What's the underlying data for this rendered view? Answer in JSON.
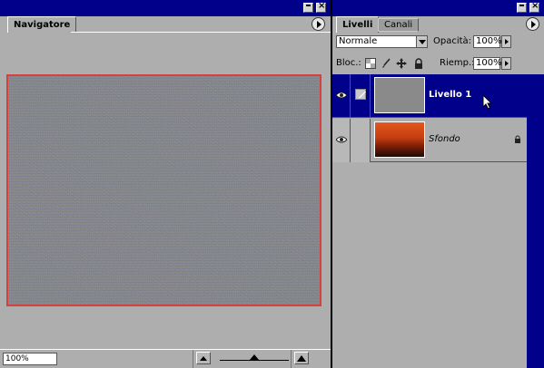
{
  "navigator": {
    "tab": "Navigatore",
    "zoom": "100%"
  },
  "layers": {
    "tabs": [
      "Livelli",
      "Canali"
    ],
    "blend_mode": "Normale",
    "opacity_label": "Opacità:",
    "opacity_value": "100%",
    "lock_label": "Bloc.:",
    "fill_label": "Riemp.:",
    "fill_value": "100%",
    "items": [
      {
        "name": "Livello 1",
        "selected": true,
        "visible": true
      },
      {
        "name": "Sfondo",
        "selected": false,
        "visible": true,
        "locked": true
      }
    ]
  },
  "colors": {
    "title_bar": "#00008b",
    "panel_bg": "#aeaeae",
    "navigator_box": "#d84040",
    "selection": "#00008b"
  },
  "icons": [
    "minimize-icon",
    "close-icon",
    "panel-menu-icon",
    "eye-icon",
    "brush-icon",
    "lock-transparency-icon",
    "lock-paint-icon",
    "lock-move-icon",
    "lock-all-icon",
    "zoom-out-icon",
    "zoom-in-icon"
  ]
}
